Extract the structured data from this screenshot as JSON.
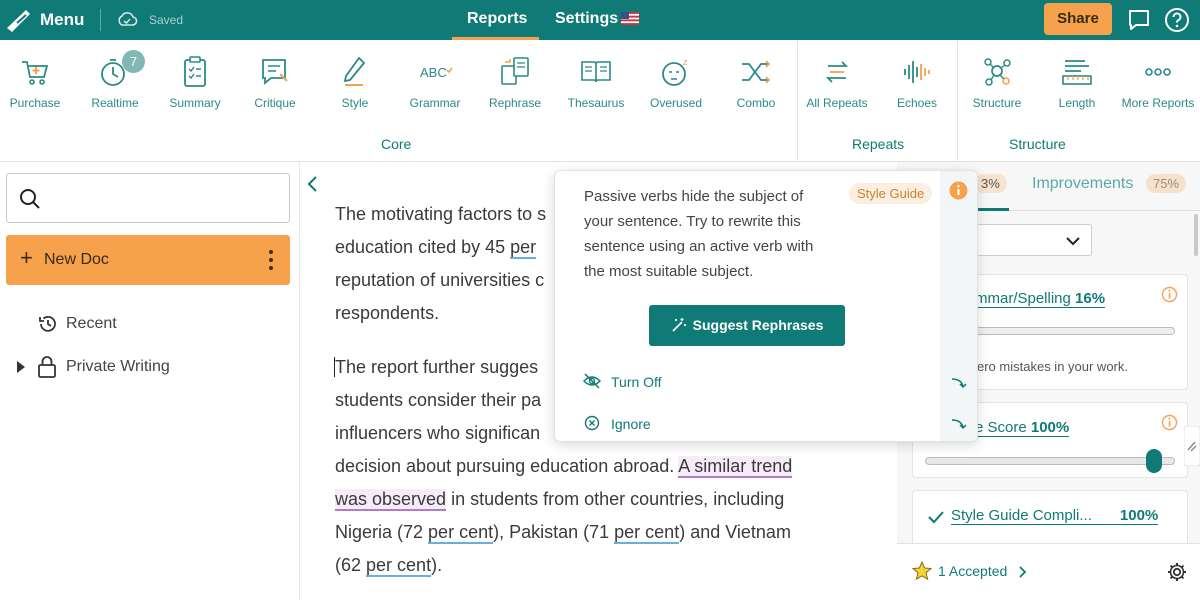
{
  "topbar": {
    "menu_label": "Menu",
    "saved_label": "Saved",
    "tabs": {
      "reports": "Reports",
      "settings": "Settings"
    },
    "share_label": "Share"
  },
  "toolbar": {
    "realtime_badge": "7",
    "tools": [
      {
        "label": "Purchase",
        "icon": "cart-icon"
      },
      {
        "label": "Realtime",
        "icon": "stopwatch-icon"
      },
      {
        "label": "Summary",
        "icon": "clipboard-icon"
      },
      {
        "label": "Critique",
        "icon": "critique-icon"
      },
      {
        "label": "Style",
        "icon": "pen-icon"
      },
      {
        "label": "Grammar",
        "icon": "abc-icon"
      },
      {
        "label": "Rephrase",
        "icon": "rephrase-icon"
      },
      {
        "label": "Thesaurus",
        "icon": "book-icon"
      },
      {
        "label": "Overused",
        "icon": "sleepy-face-icon"
      },
      {
        "label": "Combo",
        "icon": "shuffle-icon"
      },
      {
        "label": "All Repeats",
        "icon": "repeat-arrows-icon"
      },
      {
        "label": "Echoes",
        "icon": "sound-wave-icon"
      },
      {
        "label": "Structure",
        "icon": "structure-icon"
      },
      {
        "label": "Length",
        "icon": "ruler-icon"
      },
      {
        "label": "More Reports",
        "icon": "more-dots-icon"
      }
    ],
    "groups": {
      "core": "Core",
      "repeats": "Repeats",
      "structure": "Structure"
    }
  },
  "sidebar": {
    "search_placeholder": "",
    "new_doc_label": "New Doc",
    "recent_label": "Recent",
    "private_label": "Private Writing"
  },
  "editor": {
    "p1": {
      "a": "The motivating factors to s",
      "b": "education cited by 45 ",
      "b_u": "per",
      "c": "reputation of universities c",
      "d": "respondents."
    },
    "p2": {
      "a": "The report further sugges",
      "b": "students consider their pa",
      "c": "influencers who significan",
      "d1": "decision about pursuing education abroad. ",
      "d2": "A similar trend",
      "e1": "was observed",
      "e2": " in students from other countries, including",
      "f1": "Nigeria (72 ",
      "f2": "per cent",
      "f3": "), Pakistan (71 ",
      "f4": "per cent",
      "f5": ") and Vietnam",
      "g1": "(62 ",
      "g2": "per cent",
      "g3": ")."
    }
  },
  "popup": {
    "message": "Passive verbs hide the subject of your sentence. Try to rewrite this sentence using an active verb with the most suitable subject.",
    "style_guide_label": "Style Guide",
    "suggest_label": "Suggest Rephrases",
    "turn_off_label": "Turn Off",
    "ignore_label": "Ignore"
  },
  "rightpanel": {
    "first_tab_pct": "3%",
    "improvements_label": "Improvements",
    "improvements_pct": "75%",
    "cards": {
      "grammar_title": "mmar/Spelling",
      "grammar_pct": "16%",
      "grammar_text": "ero mistakes in your work.",
      "score_title": "e Score",
      "score_pct": "100%",
      "style_title": "Style Guide Compli...",
      "style_pct": "100%"
    },
    "accepted_label": "1 Accepted"
  },
  "colors": {
    "brand_teal": "#0f7a76",
    "accent_orange": "#f6a14c"
  }
}
